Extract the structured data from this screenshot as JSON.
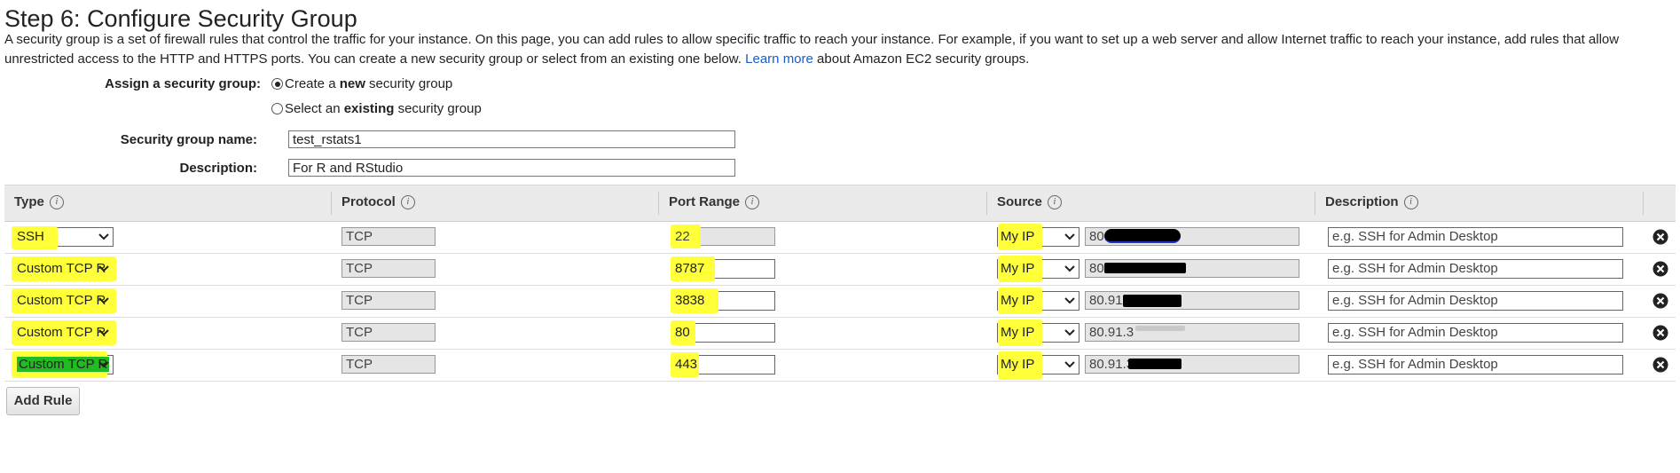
{
  "page": {
    "title": "Step 6: Configure Security Group",
    "intro_text": "A security group is a set of firewall rules that control the traffic for your instance. On this page, you can add rules to allow specific traffic to reach your instance. For example, if you want to set up a web server and allow Internet traffic to reach your instance, add rules that allow unrestricted access to the HTTP and HTTPS ports. You can create a new security group or select from an existing one below.",
    "learn_more": "Learn more",
    "intro_suffix": "about Amazon EC2 security groups."
  },
  "form": {
    "assign_label": "Assign a security group:",
    "option_new_prefix": "Create a ",
    "option_new_bold": "new",
    "option_new_suffix": " security group",
    "option_existing_prefix": "Select an ",
    "option_existing_bold": "existing",
    "option_existing_suffix": " security group",
    "selected_option": "new",
    "name_label": "Security group name:",
    "name_value": "test_rstats1",
    "desc_label": "Description:",
    "desc_value": "For R and RStudio"
  },
  "table": {
    "columns": [
      "Type",
      "Protocol",
      "Port Range",
      "Source",
      "Description"
    ],
    "rows": [
      {
        "type": "SSH",
        "protocol": "TCP",
        "port": "22",
        "source": "My IP",
        "cidr": "80.",
        "desc_placeholder": "e.g. SSH for Admin Desktop"
      },
      {
        "type": "Custom TCP R",
        "protocol": "TCP",
        "port": "8787",
        "source": "My IP",
        "cidr": "80.",
        "desc_placeholder": "e.g. SSH for Admin Desktop"
      },
      {
        "type": "Custom TCP R",
        "protocol": "TCP",
        "port": "3838",
        "source": "My IP",
        "cidr": "80.91.",
        "desc_placeholder": "e.g. SSH for Admin Desktop"
      },
      {
        "type": "Custom TCP R",
        "protocol": "TCP",
        "port": "80",
        "source": "My IP",
        "cidr": "80.91.3",
        "desc_placeholder": "e.g. SSH for Admin Desktop"
      },
      {
        "type": "Custom TCP R",
        "protocol": "TCP",
        "port": "443",
        "source": "My IP",
        "cidr": "80.91.3",
        "desc_placeholder": "e.g. SSH for Admin Desktop"
      }
    ]
  },
  "actions": {
    "add_rule": "Add Rule"
  },
  "colors": {
    "highlight": "#ffff3a",
    "link": "#1a5ec6",
    "header_bg": "#eaeaea",
    "selected_green": "#22bb22"
  }
}
